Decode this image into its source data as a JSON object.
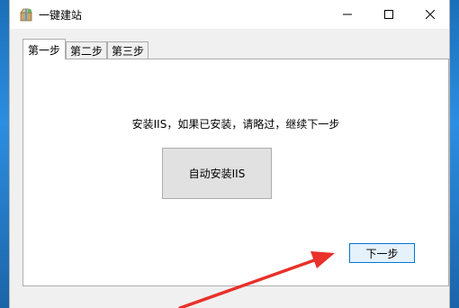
{
  "window": {
    "title": "一键建站",
    "icon": "package-icon"
  },
  "tabs": [
    {
      "label": "第一步",
      "selected": true
    },
    {
      "label": "第二步",
      "selected": false
    },
    {
      "label": "第三步",
      "selected": false
    }
  ],
  "step1": {
    "instruction": "安装IIS，如果已安装，请略过，继续下一步",
    "auto_install_label": "自动安装IIS",
    "next_label": "下一步"
  },
  "annotation": {
    "arrow_color": "#e8312a"
  }
}
